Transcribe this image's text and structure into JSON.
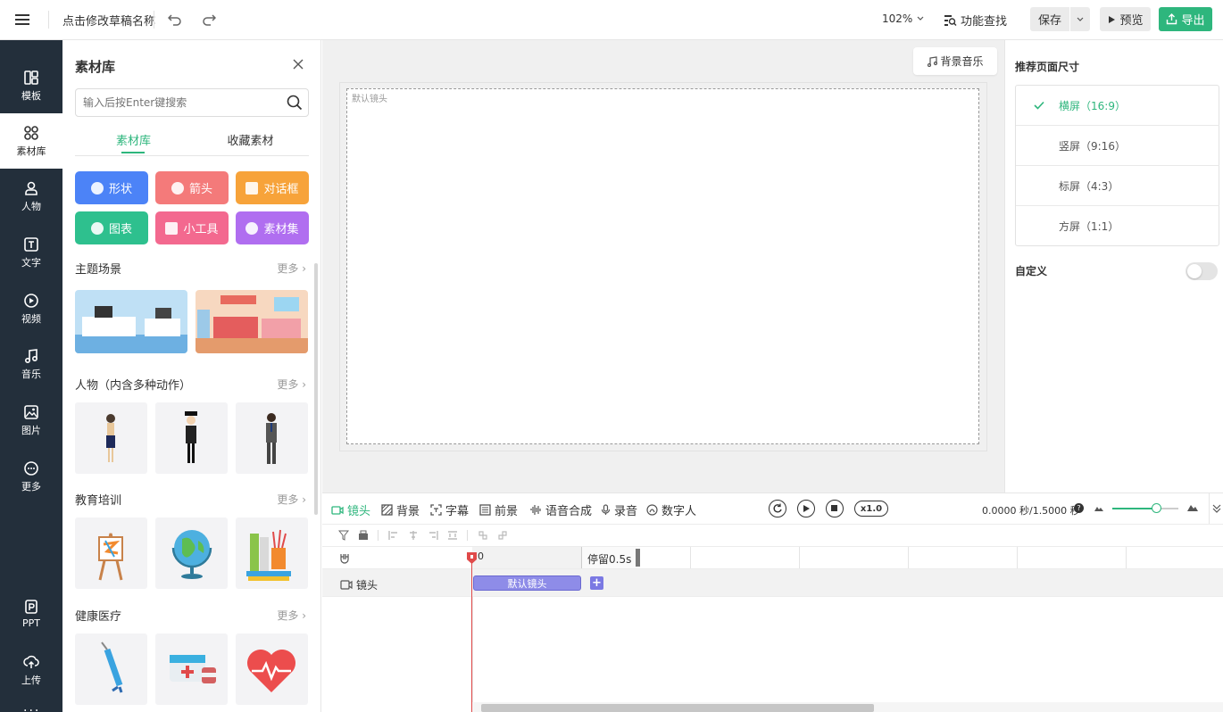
{
  "topbar": {
    "draft_name": "点击修改草稿名称",
    "zoom": "102%",
    "feature_search": "功能查找",
    "save": "保存",
    "preview": "预览",
    "export": "导出"
  },
  "sidebar": {
    "items": [
      {
        "label": "模板",
        "icon": "template-icon"
      },
      {
        "label": "素材库",
        "icon": "material-icon"
      },
      {
        "label": "人物",
        "icon": "person-icon"
      },
      {
        "label": "文字",
        "icon": "text-icon"
      },
      {
        "label": "视频",
        "icon": "video-icon"
      },
      {
        "label": "音乐",
        "icon": "music-icon"
      },
      {
        "label": "图片",
        "icon": "image-icon"
      },
      {
        "label": "更多",
        "icon": "more-icon"
      }
    ],
    "bottom": [
      {
        "label": "PPT",
        "icon": "ppt-icon"
      },
      {
        "label": "上传",
        "icon": "upload-icon"
      }
    ]
  },
  "panel": {
    "title": "素材库",
    "search_placeholder": "输入后按Enter键搜索",
    "tabs": [
      "素材库",
      "收藏素材"
    ],
    "categories": [
      {
        "label": "形状",
        "color": "#4c83f7"
      },
      {
        "label": "箭头",
        "color": "#f47a7a"
      },
      {
        "label": "对话框",
        "color": "#f7a33a"
      },
      {
        "label": "图表",
        "color": "#2ec08e"
      },
      {
        "label": "小工具",
        "color": "#f3698f"
      },
      {
        "label": "素材集",
        "color": "#b06ef0"
      }
    ],
    "sections": [
      {
        "title": "主题场景",
        "more": "更多"
      },
      {
        "title": "人物（内含多种动作）",
        "more": "更多"
      },
      {
        "title": "教育培训",
        "more": "更多"
      },
      {
        "title": "健康医疗",
        "more": "更多"
      }
    ]
  },
  "canvas": {
    "bg_music": "背景音乐",
    "default_shot": "默认镜头"
  },
  "right": {
    "title": "推荐页面尺寸",
    "options": [
      "横屏（16:9）",
      "竖屏（9:16）",
      "标屏（4:3）",
      "方屏（1:1）"
    ],
    "selected": "横屏（16:9）",
    "custom": "自定义",
    "accent": "#2eb67d"
  },
  "timeline": {
    "tabs": [
      "镜头",
      "背景",
      "字幕",
      "前景",
      "语音合成",
      "录音",
      "数字人"
    ],
    "speed": "x1.0",
    "time": "0.0000 秒/1.5000 秒",
    "ruler_zero": "0",
    "stay": "停留0.5s",
    "track_label": "镜头",
    "shot_block": "默认镜头",
    "add": "+"
  }
}
